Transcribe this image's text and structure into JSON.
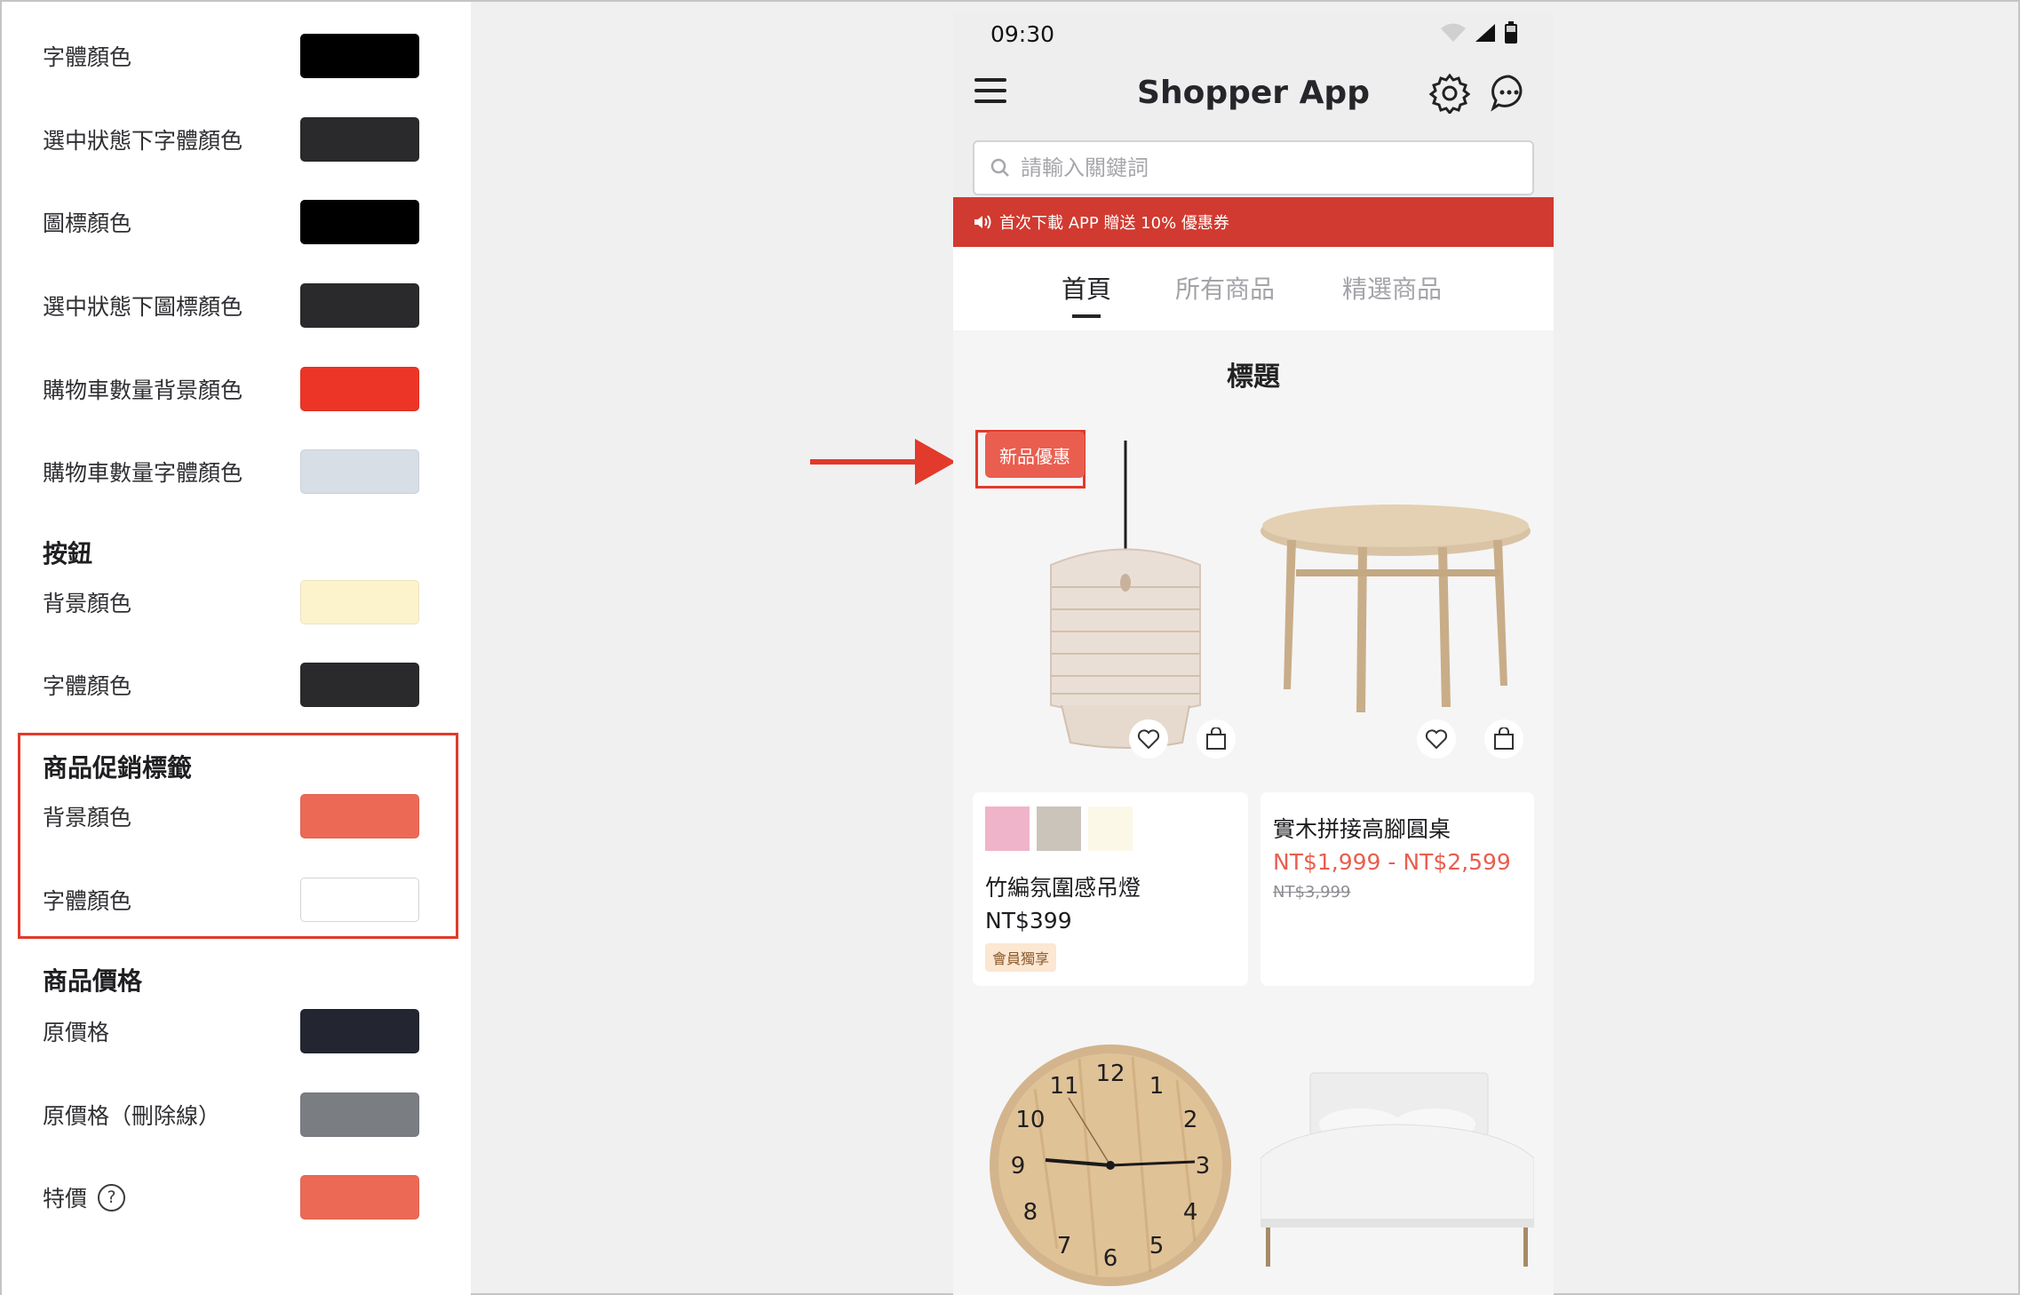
{
  "settings": {
    "rows_top": [
      {
        "label": "字體顏色",
        "color": "#000000"
      },
      {
        "label": "選中狀態下字體顏色",
        "color": "#2a2a2c"
      },
      {
        "label": "圖標顏色",
        "color": "#000000"
      },
      {
        "label": "選中狀態下圖標顏色",
        "color": "#2a2a2c"
      },
      {
        "label": "購物車數量背景顏色",
        "color": "#ec3526"
      },
      {
        "label": "購物車數量字體顏色",
        "color": "#d8dee6"
      }
    ],
    "button_section": {
      "heading": "按鈕",
      "rows": [
        {
          "label": "背景顏色",
          "color": "#fcf2cc"
        },
        {
          "label": "字體顏色",
          "color": "#2a2a2c"
        }
      ]
    },
    "promo_tag_section": {
      "heading": "商品促銷標籤",
      "rows": [
        {
          "label": "背景顏色",
          "color": "#ec6a55"
        },
        {
          "label": "字體顏色",
          "color": "#ffffff"
        }
      ]
    },
    "price_section": {
      "heading": "商品價格",
      "rows": [
        {
          "label": "原價格",
          "color": "#232630"
        },
        {
          "label": "原價格（刪除線）",
          "color": "#7a7d82"
        },
        {
          "label": "特價",
          "color": "#ec6a55"
        }
      ],
      "help_symbol": "?"
    }
  },
  "phone": {
    "status_time": "09:30",
    "app_title": "Shopper App",
    "search_placeholder": "請輸入關鍵詞",
    "promo_banner": "首次下載 APP 贈送 10% 優惠券",
    "tabs": [
      "首頁",
      "所有商品",
      "精選商品"
    ],
    "active_tab": "首頁",
    "section_title": "標題",
    "products": [
      {
        "promo_tag": "新品優惠",
        "name": "竹編氛圍感吊燈",
        "price": "NT$399",
        "member_badge": "會員獨享",
        "color_options": [
          "#efb4c9",
          "#cbc4bb",
          "#fbf8e8"
        ],
        "icons": [
          "heart-icon",
          "shopping-bag-icon"
        ]
      },
      {
        "name": "實木拼接高腳圓桌",
        "price": "NT$1,999 - NT$2,599",
        "old_price": "NT$3,999",
        "icons": [
          "heart-icon",
          "shopping-bag-icon"
        ]
      },
      {
        "name": "",
        "image": "wall-clock"
      },
      {
        "name": "",
        "image": "bed"
      }
    ]
  },
  "clock": {
    "numerals": [
      "12",
      "1",
      "2",
      "3",
      "4",
      "5",
      "6",
      "7",
      "8",
      "9",
      "10",
      "11"
    ]
  }
}
